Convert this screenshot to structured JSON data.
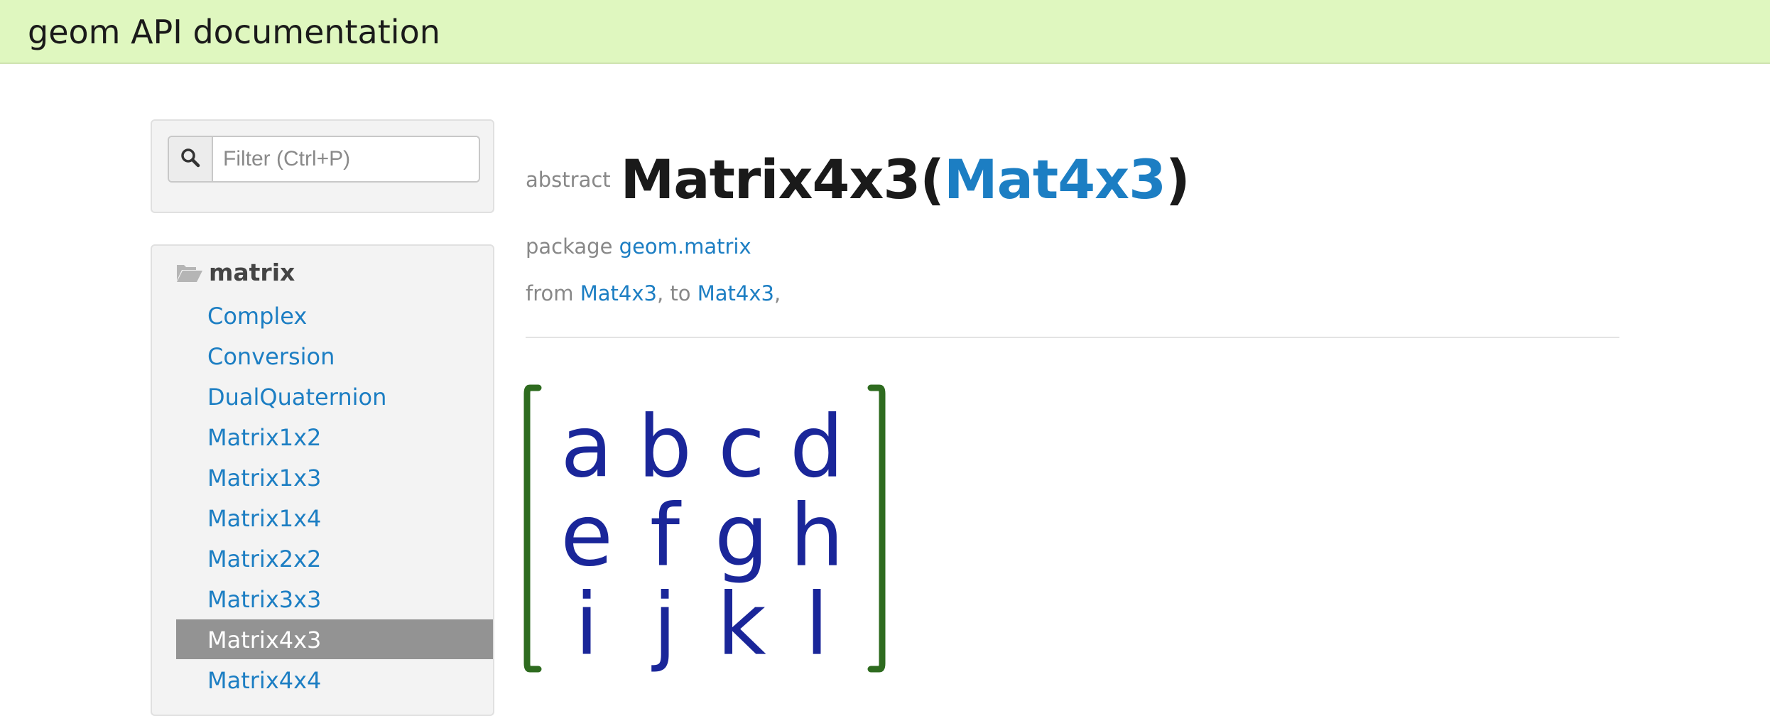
{
  "header": {
    "title": "geom API documentation"
  },
  "filter": {
    "placeholder": "Filter (Ctrl+P)",
    "value": ""
  },
  "sidebar": {
    "package_label": "matrix",
    "items": [
      {
        "label": "Complex",
        "active": false
      },
      {
        "label": "Conversion",
        "active": false
      },
      {
        "label": "DualQuaternion",
        "active": false
      },
      {
        "label": "Matrix1x2",
        "active": false
      },
      {
        "label": "Matrix1x3",
        "active": false
      },
      {
        "label": "Matrix1x4",
        "active": false
      },
      {
        "label": "Matrix2x2",
        "active": false
      },
      {
        "label": "Matrix3x3",
        "active": false
      },
      {
        "label": "Matrix4x3",
        "active": true
      },
      {
        "label": "Matrix4x4",
        "active": false
      }
    ]
  },
  "main": {
    "keyword": "abstract",
    "type_name": "Matrix4x3",
    "open_paren": "(",
    "underlying": "Mat4x3",
    "close_paren": ")",
    "package_prefix": "package",
    "package_name": "geom.matrix",
    "from_prefix": "from",
    "from_type": "Mat4x3",
    "to_sep": ", to",
    "to_type": "Mat4x3",
    "trailing": ","
  },
  "matrix_image": {
    "rows": [
      [
        "a",
        "b",
        "c",
        "d"
      ],
      [
        "e",
        "f",
        "g",
        "h"
      ],
      [
        "i",
        "j",
        "k",
        "l"
      ]
    ],
    "bracket_color": "#2e6b1f",
    "letter_color": "#1a2699"
  },
  "colors": {
    "topbar_bg": "#dff7bf",
    "link": "#1c7ec3",
    "active_item_bg": "#939393"
  }
}
